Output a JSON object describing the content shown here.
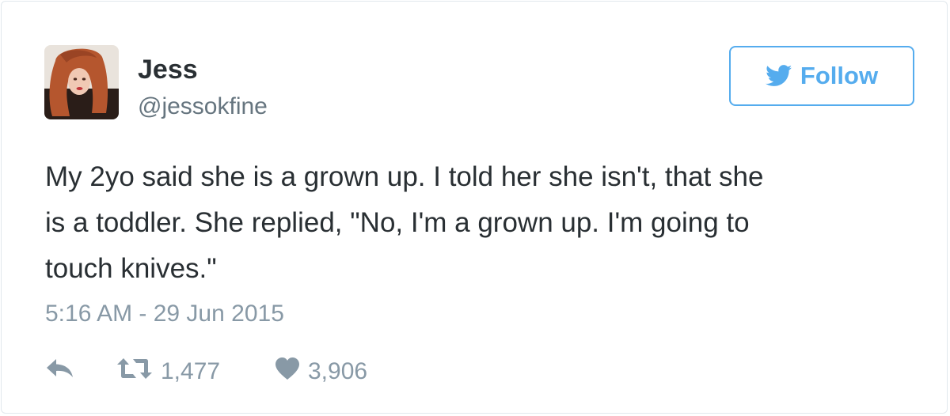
{
  "user": {
    "display_name": "Jess",
    "handle": "@jessokfine",
    "avatar_icon": "profile-photo"
  },
  "follow_button": {
    "label": "Follow",
    "icon": "twitter-bird-icon",
    "accent_color": "#55acee"
  },
  "tweet": {
    "lines": [
      "My 2yo said she is a grown up. I told her she isn't, that she",
      "is a toddler. She replied, \"No, I'm a grown up. I'm going to",
      "touch knives.\""
    ],
    "timestamp": "5:16 AM - 29 Jun 2015"
  },
  "actions": {
    "reply_icon": "reply-icon",
    "retweet_icon": "retweet-icon",
    "retweet_count": "1,477",
    "like_icon": "heart-icon",
    "like_count": "3,906"
  }
}
